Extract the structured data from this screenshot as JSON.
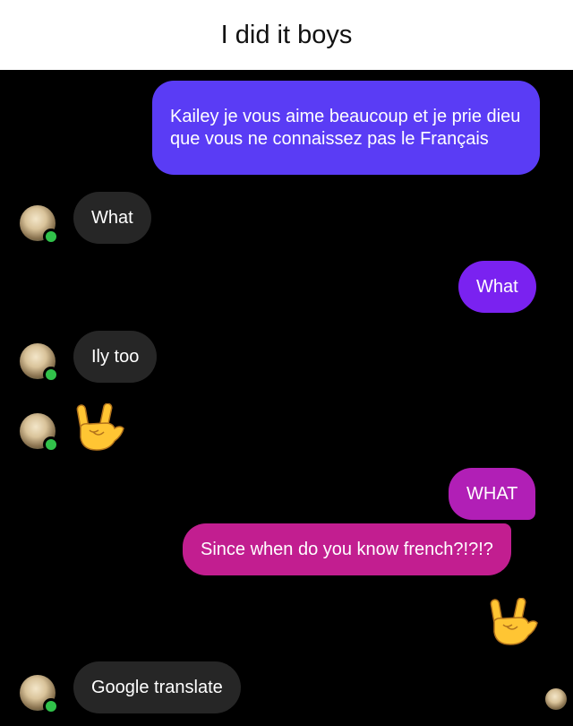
{
  "caption": {
    "title": "I did it boys"
  },
  "messages": {
    "m1": "Kailey je vous aime beaucoup et je prie dieu que vous ne connaissez pas le Français",
    "m2": "What",
    "m3": "What",
    "m4": "Ily too",
    "m6": "WHAT",
    "m7": "Since when do you know french?!?!?",
    "m9": "Google translate"
  },
  "icons": {
    "rock_hand": "sign-of-the-horns-emoji",
    "avatar": "contact-avatar"
  },
  "colors": {
    "incoming": "#262626",
    "outgoing_blue": "#5a3cf5",
    "outgoing_violet": "#7a22f0",
    "outgoing_magenta": "#b11fb6",
    "outgoing_pink": "#c21e90",
    "online_dot": "#31c24a"
  }
}
